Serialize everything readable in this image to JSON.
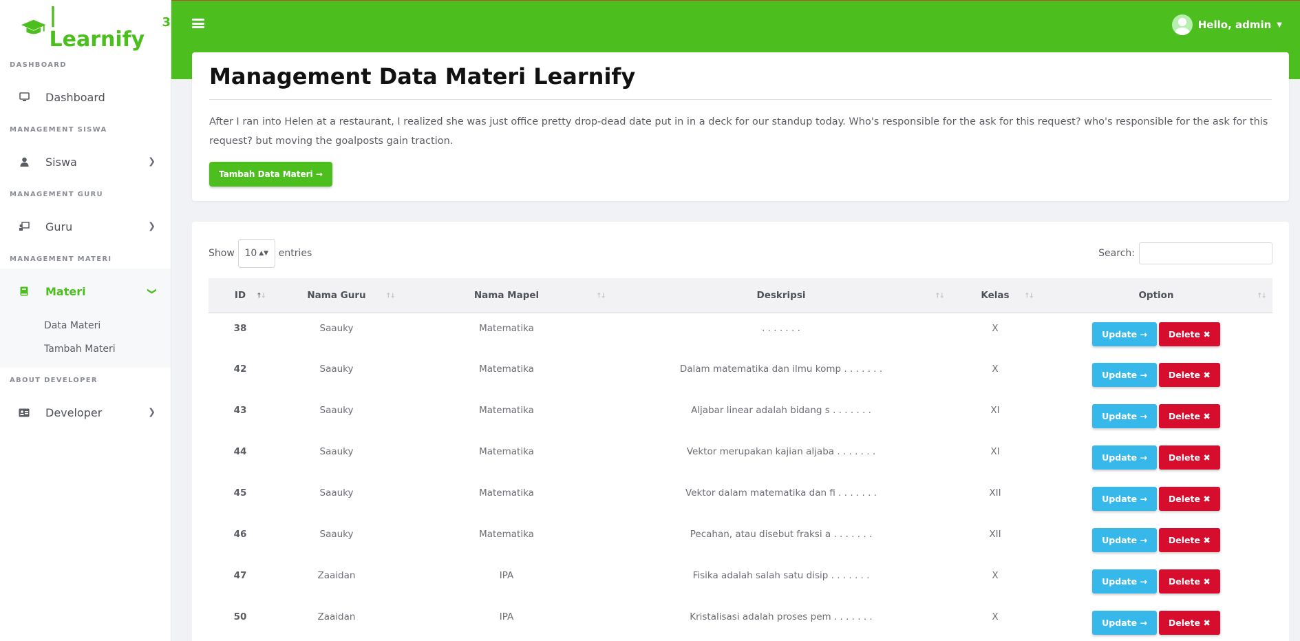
{
  "brand": {
    "name": "| Learnify",
    "sup": "3"
  },
  "sidebar": {
    "sections": [
      {
        "title": "DASHBOARD",
        "items": [
          {
            "label": "Dashboard",
            "icon": "monitor-icon"
          }
        ]
      },
      {
        "title": "MANAGEMENT SISWA",
        "items": [
          {
            "label": "Siswa",
            "icon": "user-icon"
          }
        ]
      },
      {
        "title": "MANAGEMENT GURU",
        "items": [
          {
            "label": "Guru",
            "icon": "teacher-icon"
          }
        ]
      },
      {
        "title": "MANAGEMENT MATERI",
        "items": [
          {
            "label": "Materi",
            "icon": "book-icon"
          }
        ]
      },
      {
        "title": "ABOUT DEVELOPER",
        "items": [
          {
            "label": "Developer",
            "icon": "id-card-icon"
          }
        ]
      }
    ],
    "materi_sub": [
      "Data Materi",
      "Tambah Materi"
    ]
  },
  "topbar": {
    "greeting": "Hello, admin"
  },
  "header": {
    "title": "Management Data Materi Learnify",
    "description": "After I ran into Helen at a restaurant, I realized she was just office pretty drop-dead date put in in a deck for our standup today. Who's responsible for the ask for this request? who's responsible for the ask for this request? but moving the goalposts gain traction.",
    "add_button": "Tambah Data Materi →"
  },
  "table_controls": {
    "show_label": "Show",
    "entries_value": "10",
    "entries_label": "entries",
    "search_label": "Search:"
  },
  "table": {
    "headers": [
      "ID",
      "Nama Guru",
      "Nama Mapel",
      "Deskripsi",
      "Kelas",
      "Option"
    ],
    "update_label": "Update →",
    "delete_label": "Delete ✖",
    "rows": [
      {
        "id": "38",
        "guru": "Saauky",
        "mapel": "Matematika",
        "deskripsi": ". . . . . . .",
        "kelas": "X"
      },
      {
        "id": "42",
        "guru": "Saauky",
        "mapel": "Matematika",
        "deskripsi": "Dalam matematika dan ilmu komp . . . . . . .",
        "kelas": "X"
      },
      {
        "id": "43",
        "guru": "Saauky",
        "mapel": "Matematika",
        "deskripsi": "Aljabar linear adalah bidang s . . . . . . .",
        "kelas": "XI"
      },
      {
        "id": "44",
        "guru": "Saauky",
        "mapel": "Matematika",
        "deskripsi": "Vektor merupakan kajian aljaba . . . . . . .",
        "kelas": "XI"
      },
      {
        "id": "45",
        "guru": "Saauky",
        "mapel": "Matematika",
        "deskripsi": "Vektor dalam matematika dan fi . . . . . . .",
        "kelas": "XII"
      },
      {
        "id": "46",
        "guru": "Saauky",
        "mapel": "Matematika",
        "deskripsi": "Pecahan, atau disebut fraksi a . . . . . . .",
        "kelas": "XII"
      },
      {
        "id": "47",
        "guru": "Zaaidan",
        "mapel": "IPA",
        "deskripsi": "Fisika adalah salah satu disip . . . . . . .",
        "kelas": "X"
      },
      {
        "id": "50",
        "guru": "Zaaidan",
        "mapel": "IPA",
        "deskripsi": "Kristalisasi adalah proses pem . . . . . . .",
        "kelas": "X"
      }
    ]
  },
  "colors": {
    "accent": "#4cbf1f",
    "update": "#36b9ea",
    "delete": "#d60d2c"
  }
}
